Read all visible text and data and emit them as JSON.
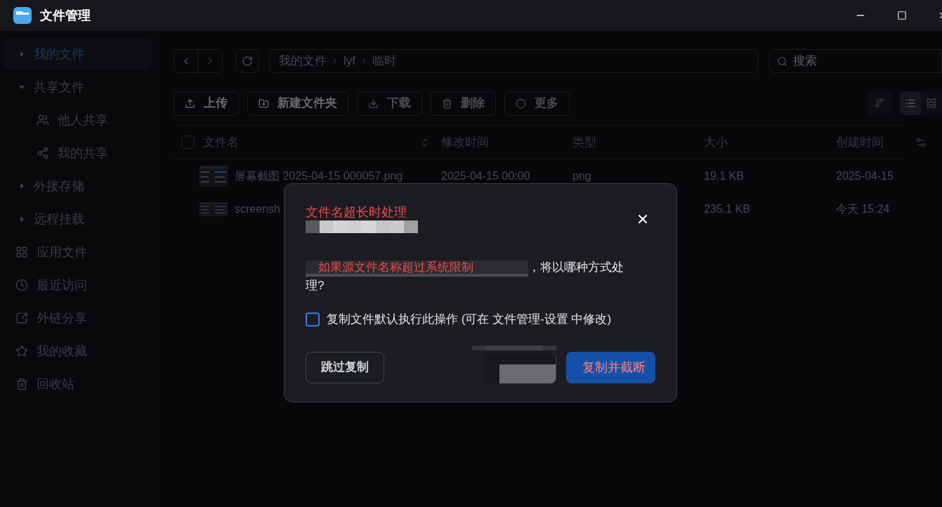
{
  "window": {
    "title": "文件管理"
  },
  "sidebar": {
    "items": [
      {
        "label": "我的文件",
        "kind": "tree",
        "expanded": false,
        "selected": true
      },
      {
        "label": "共享文件",
        "kind": "tree",
        "expanded": true,
        "selected": false,
        "children": [
          {
            "label": "他人共享",
            "selected": false
          },
          {
            "label": "我的共享",
            "selected": false
          }
        ]
      },
      {
        "label": "外接存储",
        "kind": "tree",
        "expanded": false,
        "selected": false
      },
      {
        "label": "远程挂载",
        "kind": "tree",
        "expanded": false,
        "selected": false
      },
      {
        "label": "应用文件",
        "kind": "icon",
        "selected": false
      },
      {
        "label": "最近访问",
        "kind": "icon",
        "selected": false
      },
      {
        "label": "外链分享",
        "kind": "icon",
        "selected": false
      },
      {
        "label": "我的收藏",
        "kind": "icon",
        "selected": false
      },
      {
        "label": "回收站",
        "kind": "icon",
        "selected": false
      }
    ]
  },
  "breadcrumb": [
    "我的文件",
    "lyf",
    "临时"
  ],
  "search": {
    "placeholder": "搜索"
  },
  "actions": [
    {
      "label": "上传",
      "disabled": false
    },
    {
      "label": "新建文件夹",
      "disabled": false
    },
    {
      "label": "下载",
      "disabled": true
    },
    {
      "label": "删除",
      "disabled": true
    },
    {
      "label": "更多",
      "disabled": true
    }
  ],
  "views": [
    {
      "selected": true
    },
    {
      "selected": false
    }
  ],
  "table": {
    "select_all_checked": false,
    "columns": [
      "文件名",
      "修改时间",
      "类型",
      "大小",
      "创建时间"
    ],
    "rows": [
      {
        "name": "屏幕截图 2025-04-15 000057.png",
        "modified": "2025-04-15 00:00",
        "type": "png",
        "size": "19.1 KB",
        "created": "2025-04-15"
      },
      {
        "name": "screensh",
        "size": "235.1 KB",
        "created": "今天 15:24"
      }
    ]
  },
  "dialog": {
    "title": "文件名超长时处理",
    "message_highlight": "如果源文件名称超过系统限制",
    "message_rest": "，将以哪种方式处理?",
    "remember": {
      "label": "复制文件默认执行此操作 (可在 文件管理-设置 中修改)",
      "checked": false
    },
    "buttons": [
      {
        "label": "跳过复制",
        "kind": "secondary"
      },
      {
        "kind": "masked"
      },
      {
        "label": "复制并截断",
        "kind": "primary"
      }
    ]
  }
}
